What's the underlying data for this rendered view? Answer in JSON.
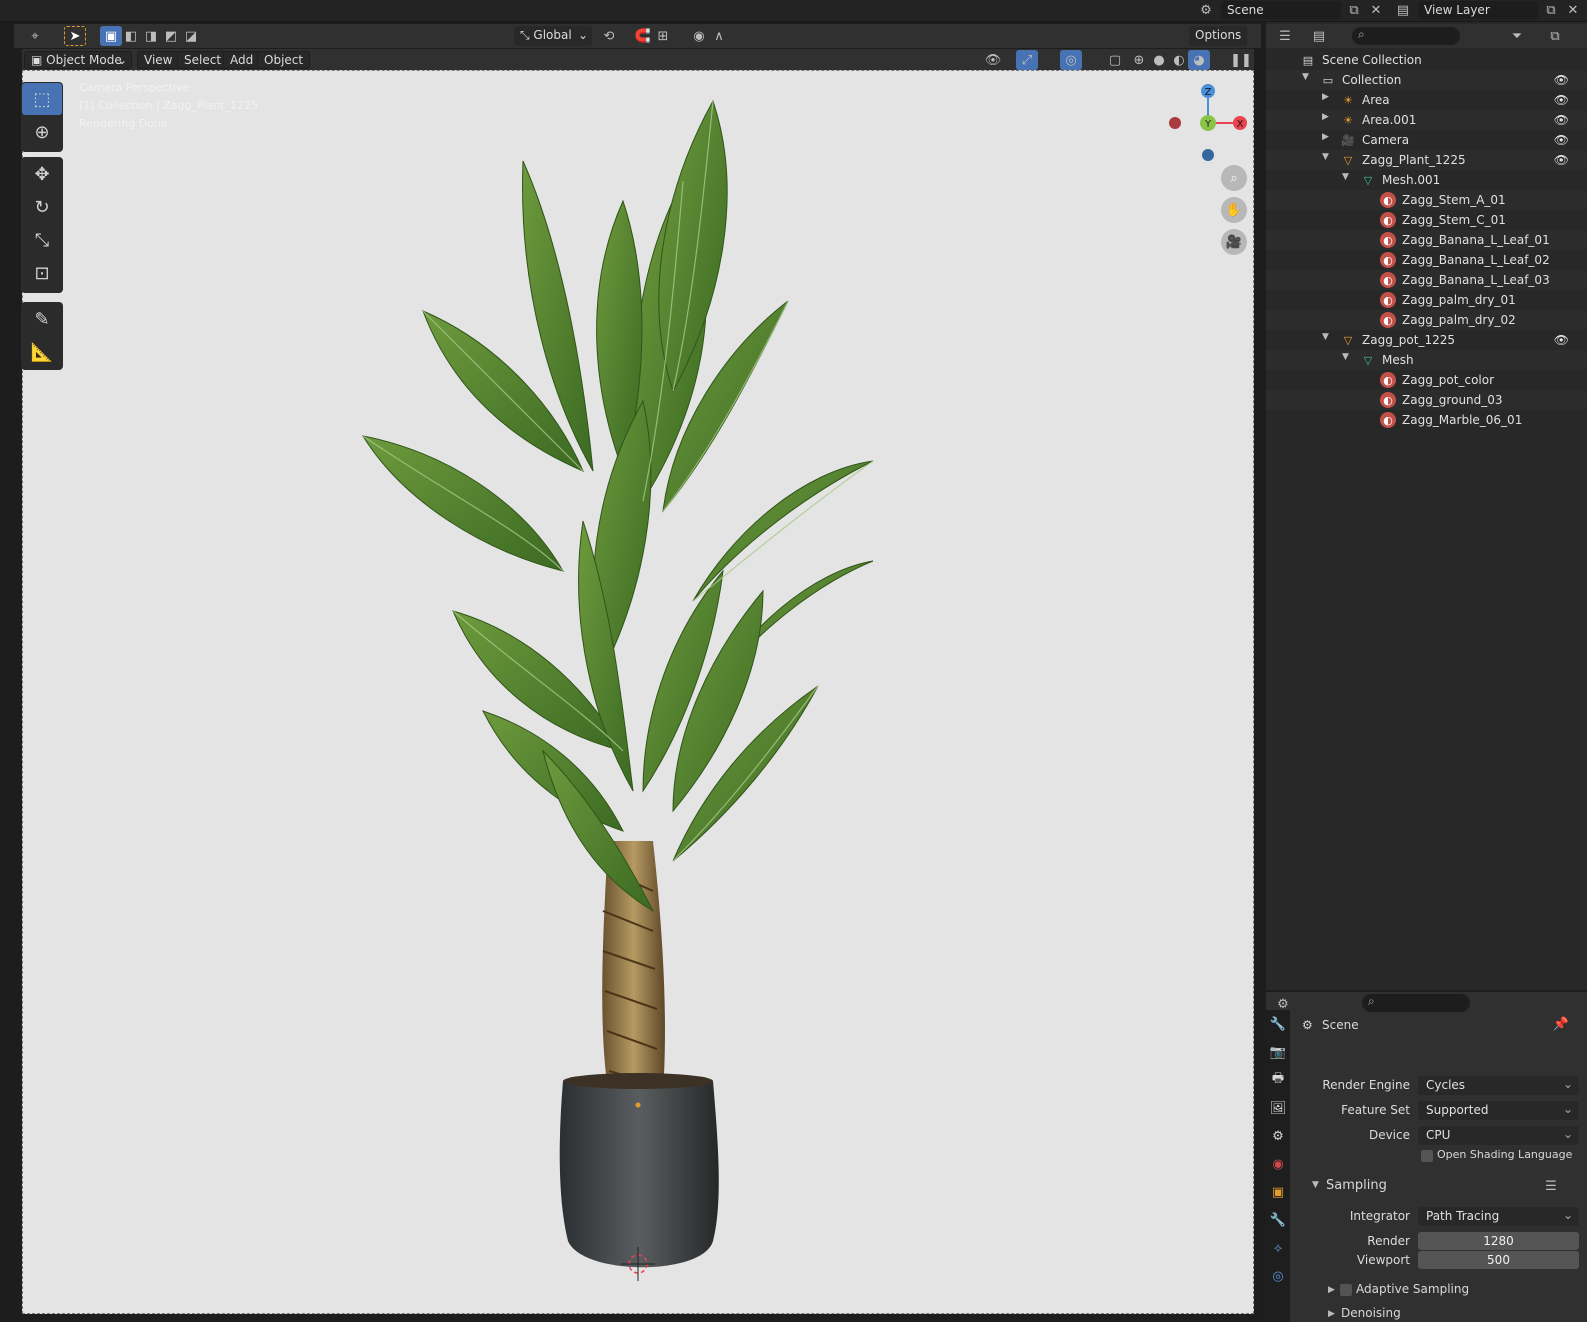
{
  "topbar": {
    "scene_label": "Scene",
    "view_layer_label": "View Layer"
  },
  "view3d_header": {
    "transform_orientation": "Global",
    "options_label": "Options"
  },
  "view3d_subheader": {
    "mode_label": "Object Mode",
    "menus": [
      "View",
      "Select",
      "Add",
      "Object"
    ]
  },
  "viewport": {
    "overlay_lines": [
      "Camera Perspective",
      "(1) Collection | Zagg_Plant_1225",
      "Rendering Done"
    ],
    "gizmo": {
      "z": "Z",
      "y": "Y",
      "x": "X"
    }
  },
  "outliner": {
    "rows": [
      {
        "label": "Scene Collection",
        "indent": 0,
        "icon": "scene-collection-icon",
        "twisty": "",
        "eye": false
      },
      {
        "label": "Collection",
        "indent": 1,
        "icon": "collection-icon",
        "twisty": "▼",
        "eye": true
      },
      {
        "label": "Area",
        "indent": 2,
        "icon": "light-icon",
        "twisty": "▶",
        "eye": true
      },
      {
        "label": "Area.001",
        "indent": 2,
        "icon": "light-icon",
        "twisty": "▶",
        "eye": true
      },
      {
        "label": "Camera",
        "indent": 2,
        "icon": "camera-icon",
        "twisty": "▶",
        "eye": true
      },
      {
        "label": "Zagg_Plant_1225",
        "indent": 2,
        "icon": "mesh-object-icon",
        "twisty": "▼",
        "eye": true
      },
      {
        "label": "Mesh.001",
        "indent": 3,
        "icon": "mesh-data-icon",
        "twisty": "▼",
        "eye": false
      },
      {
        "label": "Zagg_Stem_A_01",
        "indent": 4,
        "icon": "material-icon",
        "twisty": "",
        "eye": false
      },
      {
        "label": "Zagg_Stem_C_01",
        "indent": 4,
        "icon": "material-icon",
        "twisty": "",
        "eye": false
      },
      {
        "label": "Zagg_Banana_L_Leaf_01",
        "indent": 4,
        "icon": "material-icon",
        "twisty": "",
        "eye": false
      },
      {
        "label": "Zagg_Banana_L_Leaf_02",
        "indent": 4,
        "icon": "material-icon",
        "twisty": "",
        "eye": false
      },
      {
        "label": "Zagg_Banana_L_Leaf_03",
        "indent": 4,
        "icon": "material-icon",
        "twisty": "",
        "eye": false
      },
      {
        "label": "Zagg_palm_dry_01",
        "indent": 4,
        "icon": "material-icon",
        "twisty": "",
        "eye": false
      },
      {
        "label": "Zagg_palm_dry_02",
        "indent": 4,
        "icon": "material-icon",
        "twisty": "",
        "eye": false
      },
      {
        "label": "Zagg_pot_1225",
        "indent": 2,
        "icon": "mesh-object-icon",
        "twisty": "▼",
        "eye": true
      },
      {
        "label": "Mesh",
        "indent": 3,
        "icon": "mesh-data-icon",
        "twisty": "▼",
        "eye": false
      },
      {
        "label": "Zagg_pot_color",
        "indent": 4,
        "icon": "material-icon",
        "twisty": "",
        "eye": false
      },
      {
        "label": "Zagg_ground_03",
        "indent": 4,
        "icon": "material-icon",
        "twisty": "",
        "eye": false
      },
      {
        "label": "Zagg_Marble_06_01",
        "indent": 4,
        "icon": "material-icon",
        "twisty": "",
        "eye": false
      }
    ]
  },
  "properties": {
    "context_label": "Scene",
    "render_engine_label": "Render Engine",
    "render_engine": "Cycles",
    "feature_set_label": "Feature Set",
    "feature_set": "Supported",
    "device_label": "Device",
    "device": "CPU",
    "osl_label": "Open Shading Language",
    "sampling_label": "Sampling",
    "integrator_label": "Integrator",
    "integrator": "Path Tracing",
    "render_label": "Render",
    "render_samples": "1280",
    "viewport_label": "Viewport",
    "viewport_samples": "500",
    "adaptive_label": "Adaptive Sampling",
    "denoising_label": "Denoising"
  },
  "colors": {
    "accent": "#4772b3",
    "axis_x": "#e8434f",
    "axis_y": "#8bc34a",
    "axis_z": "#4a90d9"
  }
}
